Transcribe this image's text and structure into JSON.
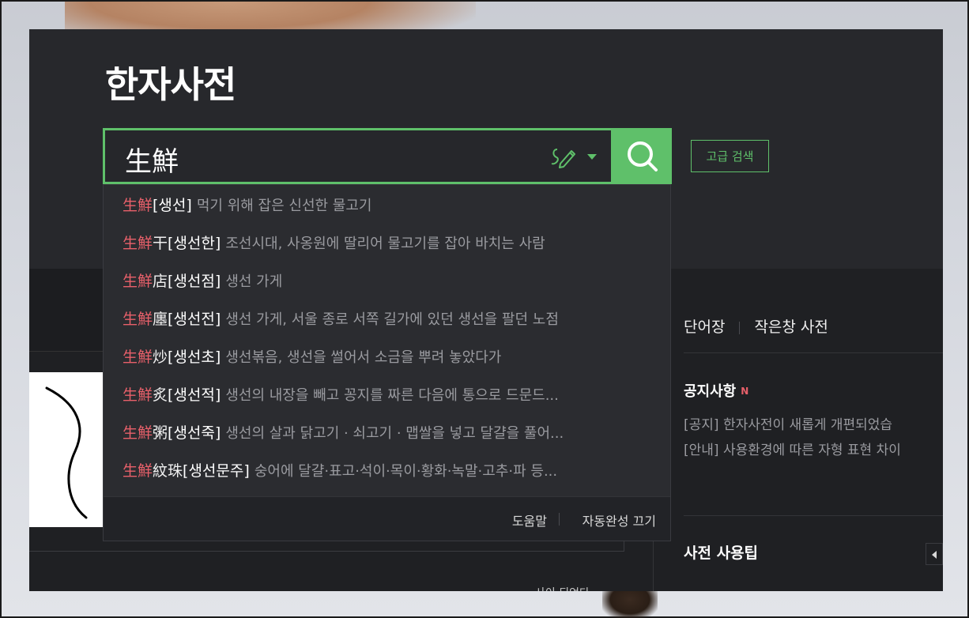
{
  "header": {
    "title": "한자사전"
  },
  "search": {
    "value": "生鮮",
    "advanced_label": "고급 검색"
  },
  "suggestions": [
    {
      "hl": "生鮮",
      "rest": "",
      "reading": "[생선]",
      "def": "먹기 위해 잡은 신선한 물고기"
    },
    {
      "hl": "生鮮",
      "rest": "干",
      "reading": "[생선한]",
      "def": "조선시대, 사옹원에 딸리어 물고기를 잡아 바치는 사람"
    },
    {
      "hl": "生鮮",
      "rest": "店",
      "reading": "[생선점]",
      "def": "생선 가게"
    },
    {
      "hl": "生鮮",
      "rest": "廛",
      "reading": "[생선전]",
      "def": "생선 가게, 서울 종로 서쪽 길가에 있던 생선을 팔던 노점"
    },
    {
      "hl": "生鮮",
      "rest": "炒",
      "reading": "[생선초]",
      "def": "생선볶음, 생선을 썰어서 소금을 뿌려 놓았다가"
    },
    {
      "hl": "生鮮",
      "rest": "炙",
      "reading": "[생선적]",
      "def": "생선의 내장을 빼고 꽁지를 짜른 다음에 통으로 드문드..."
    },
    {
      "hl": "生鮮",
      "rest": "粥",
      "reading": "[생선죽]",
      "def": "생선의 살과 닭고기 · 쇠고기 · 맵쌀을 넣고 달걀을 풀어..."
    },
    {
      "hl": "生鮮",
      "rest": "紋珠",
      "reading": "[생선문주]",
      "def": "숭어에 달걀·표고·석이·목이·황화·녹말·고추·파 등..."
    }
  ],
  "dropdown_footer": {
    "help": "도움말",
    "autocomplete_off": "자동완성 끄기"
  },
  "right": {
    "link_wordbook": "단어장",
    "link_small_dict": "작은창 사전",
    "notice_title": "공지사항",
    "notice_new": "N",
    "notices": [
      "[공지] 한자사전이 새롭게 개편되었습",
      "[안내] 사용환경에 따른 자형 표현 차이"
    ],
    "tips_title": "사전 사용팁"
  },
  "bottom_text": "사이 되었다",
  "colors": {
    "accent": "#5fc06a",
    "highlight": "#e8606a",
    "panel": "#1f2023"
  }
}
